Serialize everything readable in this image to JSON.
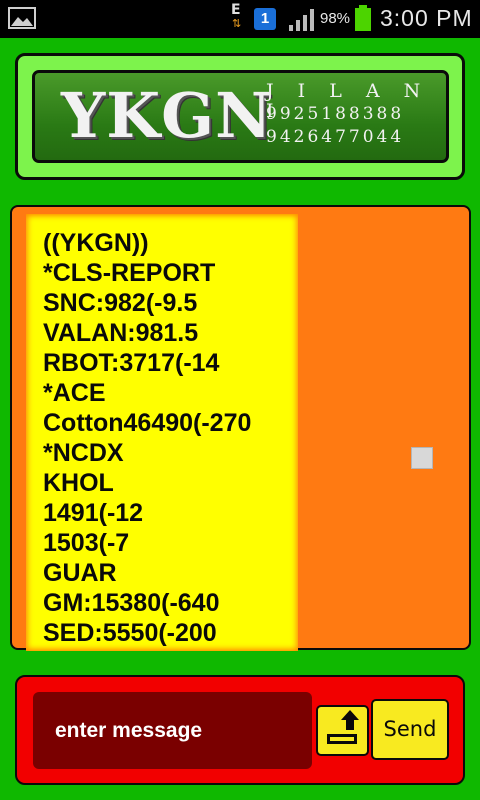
{
  "status_bar": {
    "notification_badge": "1",
    "network_type": "E",
    "battery_percent": "98%",
    "time": "3:00 PM"
  },
  "header": {
    "logo": "YKGN",
    "name": "J I L A N I",
    "phones": [
      "9925188388",
      "9426477044"
    ]
  },
  "messages": {
    "lines": [
      "((YKGN))",
      "*CLS-REPORT",
      "SNC:982(-9.5",
      "VALAN:981.5",
      "RBOT:3717(-14",
      "*ACE",
      "Cotton46490(-270",
      "*NCDX",
      "KHOL",
      "1491(-12",
      "1503(-7",
      "GUAR",
      "GM:15380(-640",
      "SED:5550(-200"
    ]
  },
  "compose": {
    "input_value": "enter message",
    "send_label": "Send"
  },
  "colors": {
    "background": "#0fb800",
    "header_border": "#7df34c",
    "message_panel": "#ff7a12",
    "message_bubble": "#ffff00",
    "compose_bar": "#f20000",
    "input": "#7a0000",
    "button": "#f8ea20"
  }
}
